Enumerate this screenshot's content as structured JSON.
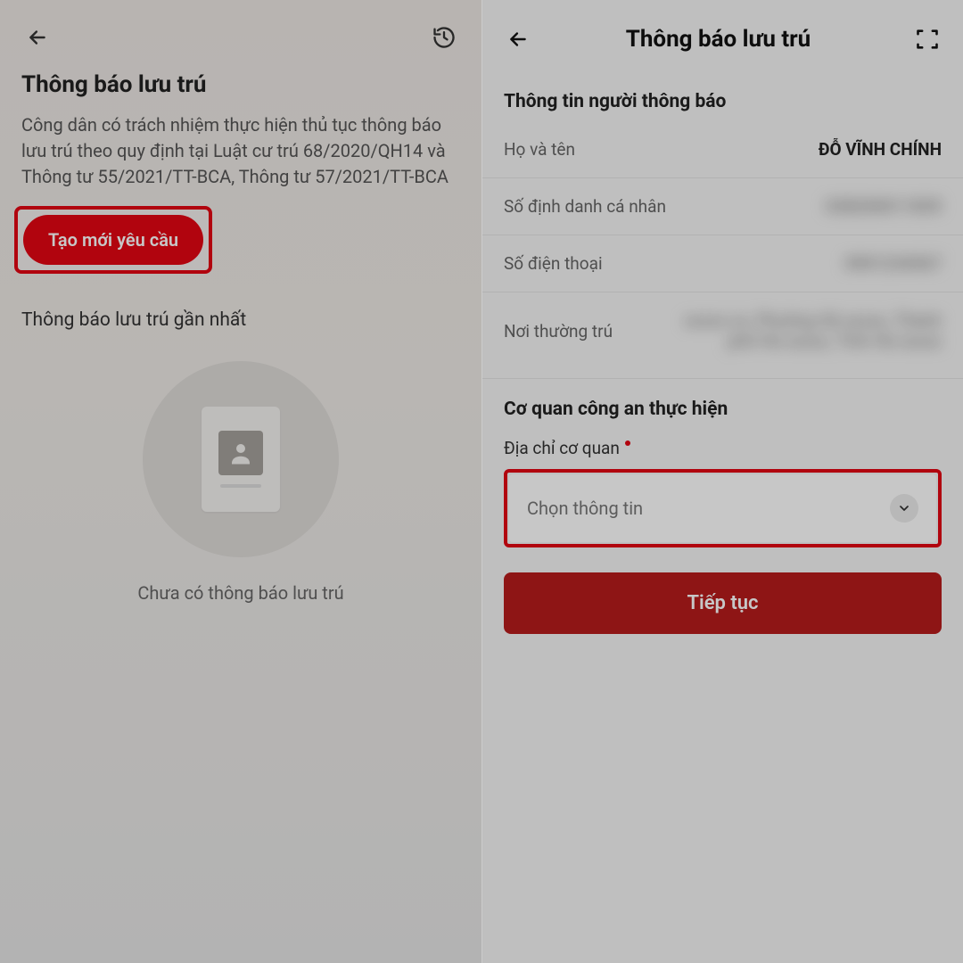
{
  "left": {
    "title": "Thông báo lưu trú",
    "description": "Công dân có trách nhiệm thực hiện thủ tục thông báo lưu trú theo quy định tại Luật cư trú 68/2020/QH14 và Thông tư 55/2021/TT-BCA, Thông tư 57/2021/TT-BCA",
    "create_button": "Tạo mới yêu cầu",
    "recent_title": "Thông báo lưu trú gần nhất",
    "empty_text": "Chưa có thông báo lưu trú"
  },
  "right": {
    "header_title": "Thông báo lưu trú",
    "reporter_section": "Thông tin người thông báo",
    "rows": {
      "name_label": "Họ và tên",
      "name_value": "ĐỖ VĨNH CHÍNH",
      "id_label": "Số định danh cá nhân",
      "id_value": "038200011839",
      "phone_label": "Số điện thoại",
      "phone_value": "0901234567",
      "residence_label": "Nơi thường trú",
      "residence_value": "xxxxx xx, Phường Xã xxxxx, Thành phố Hà xxxxx, Tỉnh Hà xxxxx"
    },
    "agency_section": "Cơ quan công an thực hiện",
    "agency_address_label": "Địa chỉ cơ quan",
    "select_placeholder": "Chọn thông tin",
    "continue_button": "Tiếp tục"
  }
}
